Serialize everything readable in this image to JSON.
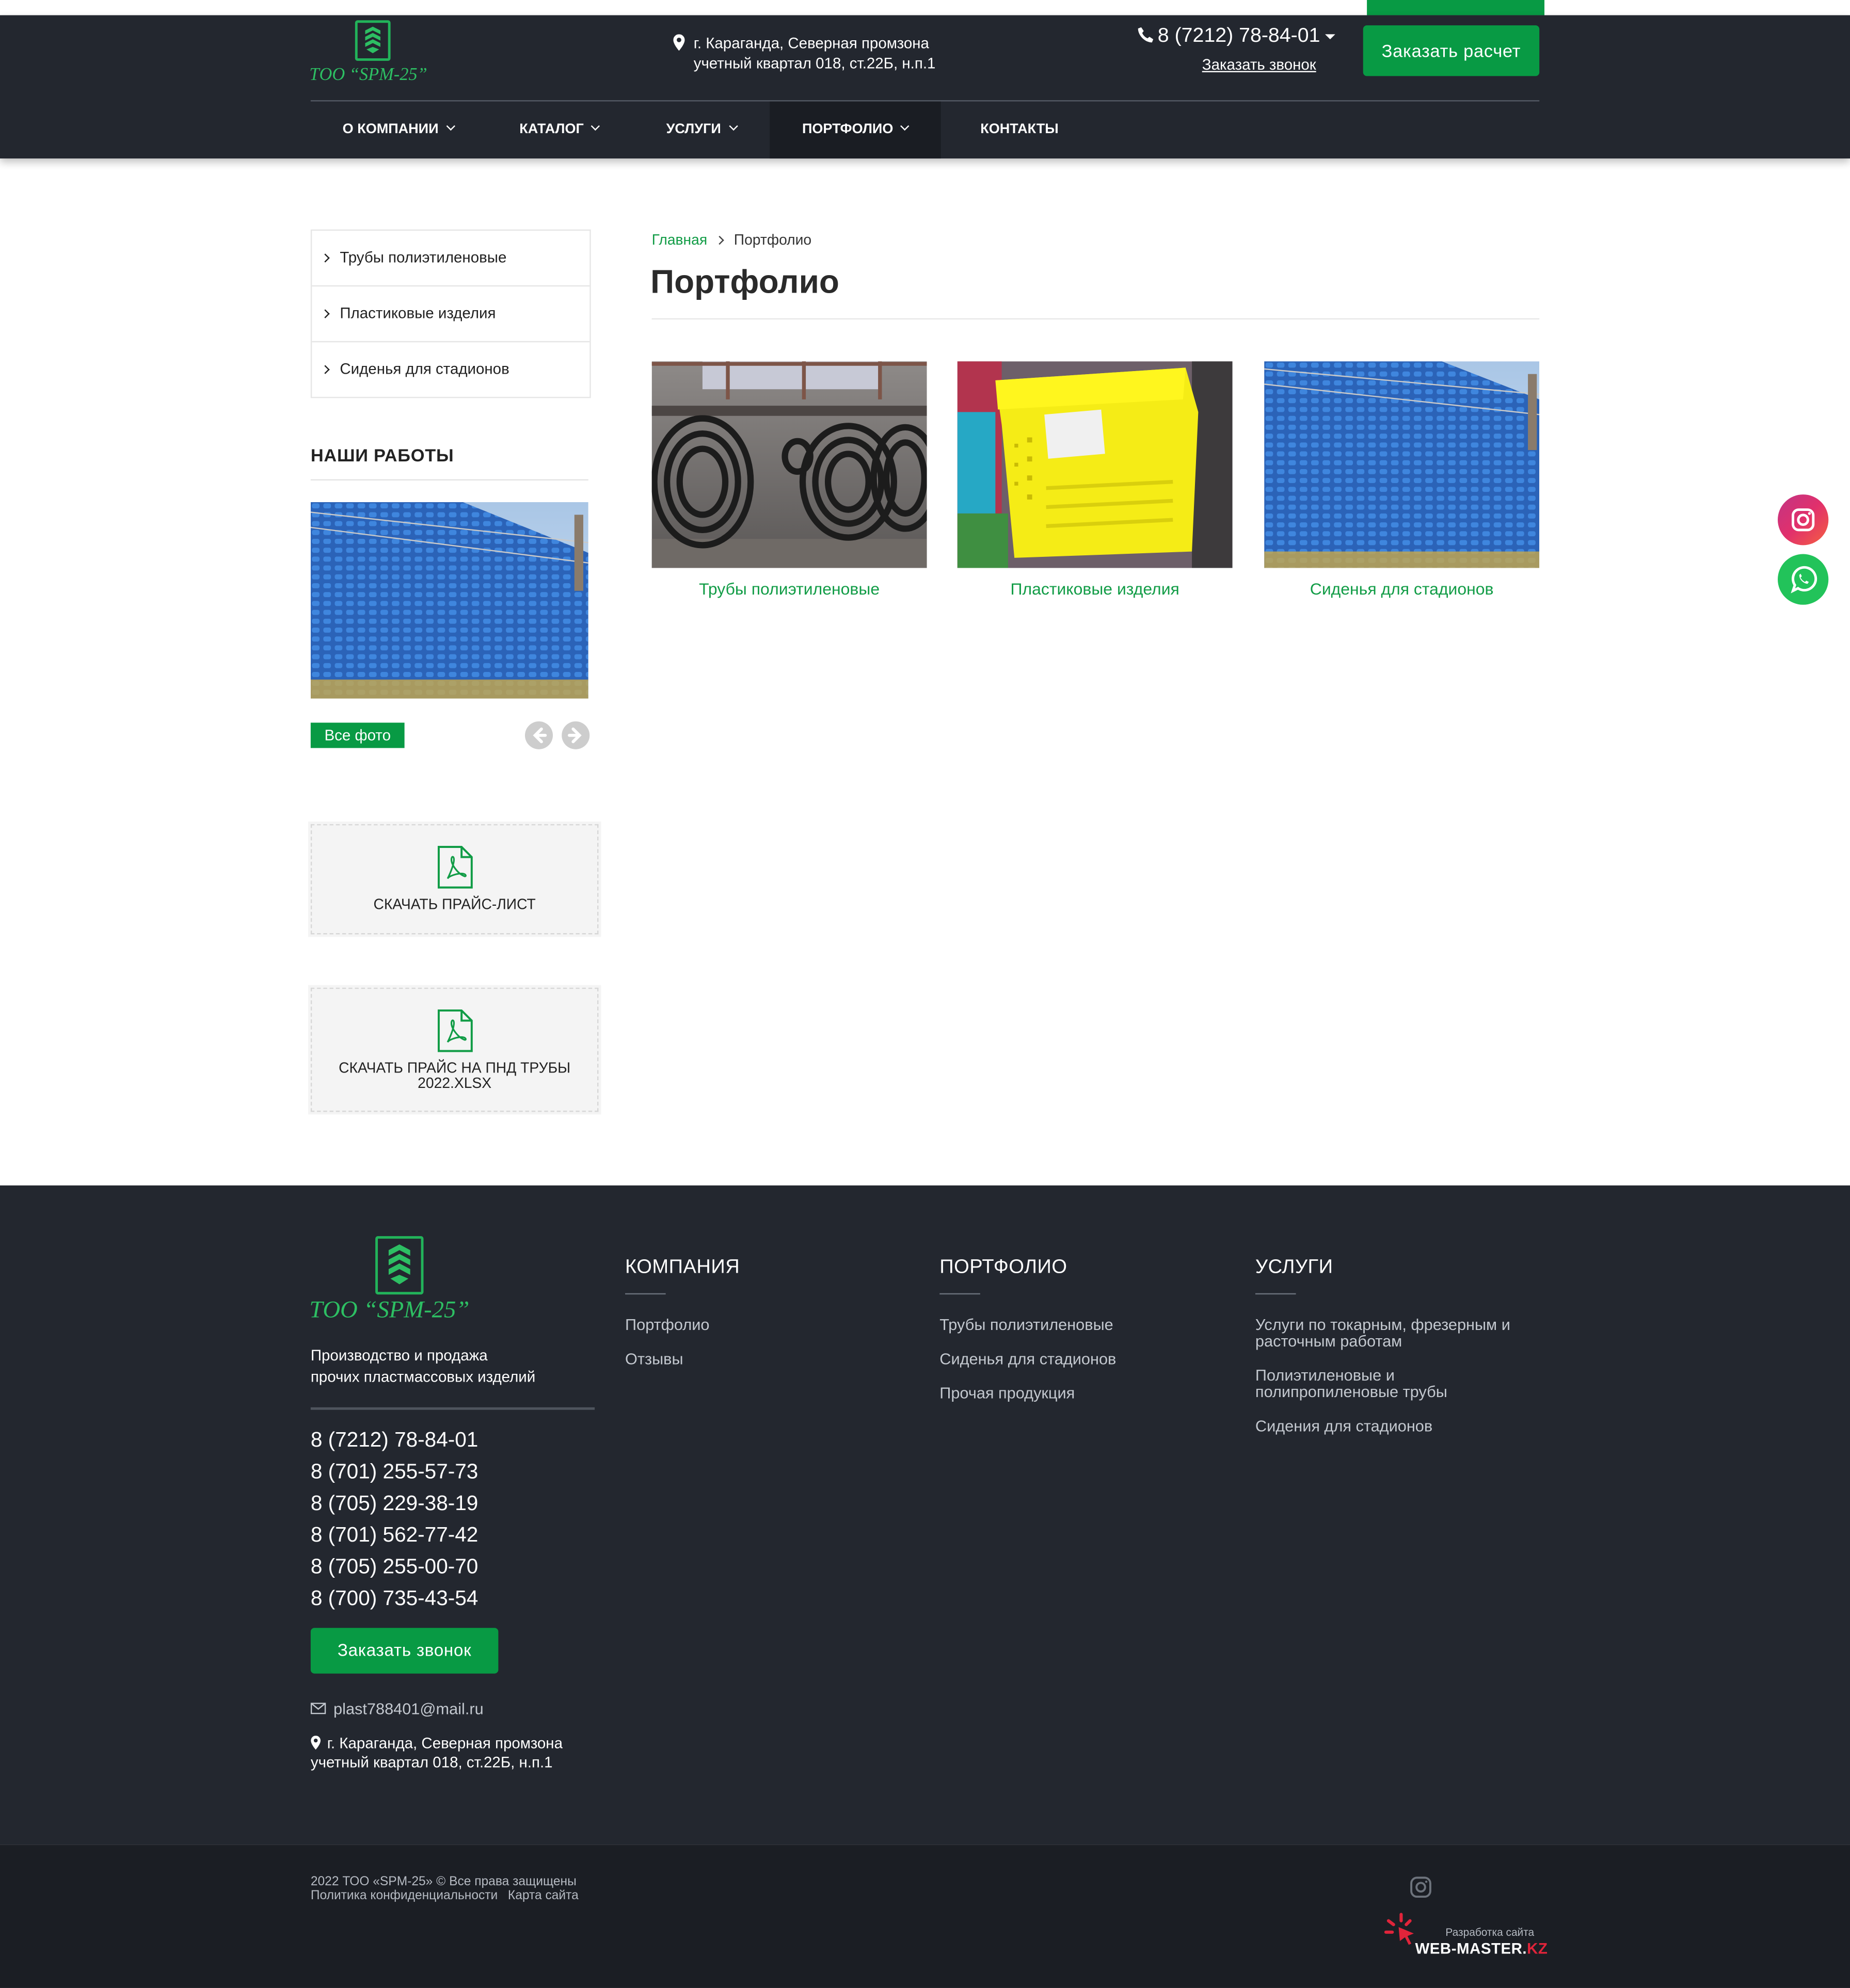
{
  "brand": {
    "logo_text": "ТОО “SPM-25”",
    "accent_color": "#089a44",
    "header_bg": "#23272f"
  },
  "header": {
    "address_line1": "г. Караганда, Северная промзона",
    "address_line2": "учетный квартал 018, ст.22Б, н.п.1",
    "phone": "8 (7212) 78-84-01",
    "callback_label": "Заказать звонок",
    "order_button": "Заказать расчет"
  },
  "nav": {
    "items": [
      {
        "label": "О КОМПАНИИ"
      },
      {
        "label": "КАТАЛОГ"
      },
      {
        "label": "УСЛУГИ"
      },
      {
        "label": "ПОРТФОЛИО"
      },
      {
        "label": "КОНТАКТЫ"
      }
    ],
    "active_index": 3
  },
  "sidebar": {
    "menu": [
      {
        "label": "Трубы полиэтиленовые"
      },
      {
        "label": "Пластиковые изделия"
      },
      {
        "label": "Сиденья для стадионов"
      }
    ],
    "works_title": "НАШИ РАБОТЫ",
    "all_photos": "Все фото",
    "price_list_label": "СКАЧАТЬ ПРАЙС-ЛИСТ",
    "price_pnd_line1": "СКАЧАТЬ ПРАЙС НА ПНД ТРУБЫ",
    "price_pnd_line2": "2022.XLSX"
  },
  "breadcrumb": {
    "home": "Главная",
    "current": "Портфолио"
  },
  "page_title": "Портфолио",
  "portfolio": [
    {
      "caption": "Трубы полиэтиленовые"
    },
    {
      "caption": "Пластиковые изделия"
    },
    {
      "caption": "Сиденья для стадионов"
    }
  ],
  "social": {
    "icons": [
      "instagram-icon",
      "whatsapp-icon"
    ]
  },
  "footer": {
    "description_line1": "Производство и продажа",
    "description_line2": "прочих пластмассовых изделий",
    "phones": [
      "8 (7212) 78-84-01",
      "8 (701) 255-57-73",
      "8 (705) 229-38-19",
      "8 (701) 562-77-42",
      "8 (705) 255-00-70",
      "8 (700) 735-43-54"
    ],
    "callback_button": "Заказать звонок",
    "email": "plast788401@mail.ru",
    "address_line1": "г. Караганда, Северная промзона",
    "address_line2": "учетный квартал 018, ст.22Б, н.п.1",
    "columns": {
      "company": {
        "title": "КОМПАНИЯ",
        "links": [
          "Портфолио",
          "Отзывы"
        ]
      },
      "portfolio": {
        "title": "ПОРТФОЛИО",
        "links": [
          "Трубы полиэтиленовые",
          "Сиденья для стадионов",
          "Прочая продукция"
        ]
      },
      "services": {
        "title": "УСЛУГИ",
        "links": [
          {
            "line1": "Услуги по токарным, фрезерным и",
            "line2": "расточным работам"
          },
          {
            "line1": "Полиэтиленовые и",
            "line2": "полипропиленовые трубы"
          },
          {
            "line1": "Сидения для стадионов",
            "line2": ""
          }
        ]
      }
    }
  },
  "bottom": {
    "copyright": "2022 ТОО «SPM-25» © Все права защищены",
    "privacy": "Политика конфиденциальности",
    "sitemap": "Карта сайта",
    "dev_small": "Разработка сайта",
    "dev_brand": "WEB-MASTER.",
    "dev_brand_tld": "KZ"
  }
}
